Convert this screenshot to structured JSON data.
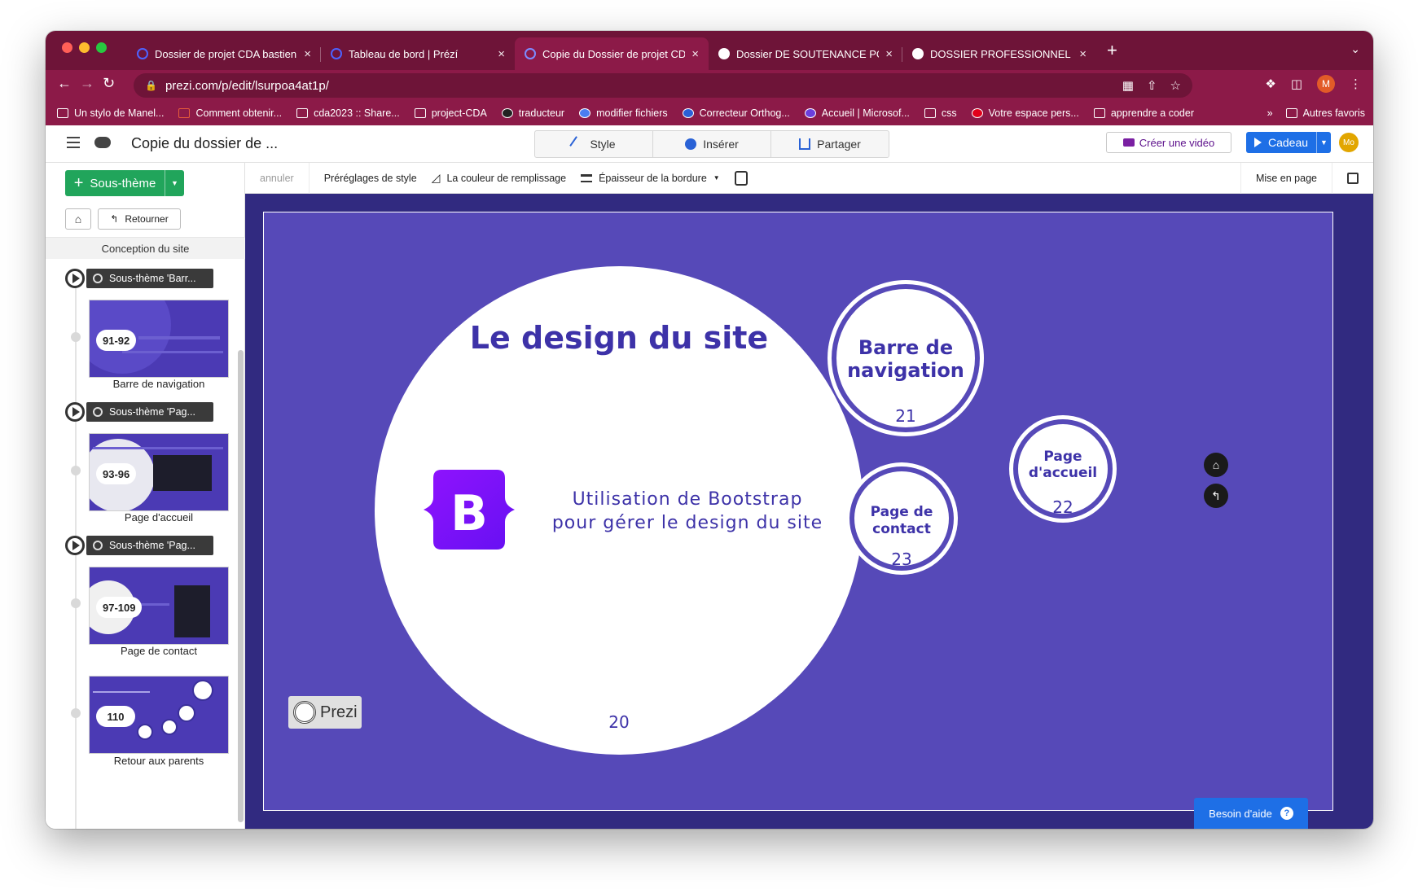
{
  "browser": {
    "tabs": [
      {
        "title": "Dossier de projet CDA bastien",
        "favicon_color": "#3b4fd8"
      },
      {
        "title": "Tableau de bord | Prézí",
        "favicon_color": "#3b4fd8"
      },
      {
        "title": "Copie du Dossier de projet CDA",
        "favicon_color": "#3b4fd8"
      },
      {
        "title": "Dossier DE SOUTENANCE POUR",
        "favicon_color": "#ffffff"
      },
      {
        "title": "DOSSIER PROFESSIONNEL (DP",
        "favicon_color": "#ffffff"
      }
    ],
    "close_glyph": "×",
    "new_tab_glyph": "+",
    "url": "prezi.com/p/edit/lsurpoa4at1p/",
    "profile_initial": "M",
    "bookmarks": [
      "Un stylo de Manel...",
      "Comment obtenir...",
      "cda2023 :: Share...",
      "project-CDA",
      "traducteur",
      "modifier fichiers",
      "Correcteur Orthog...",
      "Accueil | Microsof...",
      "css",
      "Votre espace pers...",
      "apprendre a coder"
    ],
    "bookmarks_overflow": "»",
    "other_bookmarks": "Autres favoris"
  },
  "app": {
    "doc_title": "Copie du dossier de ...",
    "segments": [
      {
        "label": "Style",
        "icon": "magic-wand-icon"
      },
      {
        "label": "Insérer",
        "icon": "plus-circle-icon"
      },
      {
        "label": "Partager",
        "icon": "share-upload-icon"
      }
    ],
    "create_video": "Créer une vidéo",
    "gift": "Cadeau",
    "user_initials": "Mo",
    "accent_color": "#1e6fe6"
  },
  "sidebar": {
    "add_label": "Sous-thème",
    "back_label": "Retourner",
    "crumb": "Conception du site",
    "subtopics": [
      {
        "tag": "Sous-thème 'Barr...",
        "badge": "91-92",
        "label": "Barre de navigation"
      },
      {
        "tag": "Sous-thème 'Pag...",
        "badge": "93-96",
        "label": "Page d'accueil"
      },
      {
        "tag": "Sous-thème 'Pag...",
        "badge": "97-109",
        "label": "Page de contact"
      }
    ],
    "last": {
      "badge": "110",
      "label": "Retour aux parents"
    }
  },
  "toolbar": {
    "undo": "annuler",
    "presets": "Préréglages de style",
    "fill": "La couleur de remplissage",
    "border": "Épaisseur de la bordure",
    "layout": "Mise en page"
  },
  "slide": {
    "title": "Le design du site",
    "logo_letter": "B",
    "line1": "Utilisation de Bootstrap",
    "line2": "pour gérer le design du site",
    "number": "20",
    "topics": [
      {
        "title_line1": "Barre de",
        "title_line2": "navigation",
        "number": "21"
      },
      {
        "title_line1": "Page",
        "title_line2": "d'accueil",
        "number": "22"
      },
      {
        "title_line1": "Page de",
        "title_line2": "contact",
        "number": "23"
      }
    ],
    "brand": "Prezi",
    "bg_color": "#5649b8",
    "text_color": "#3d32a8"
  },
  "help": {
    "label": "Besoin d'aide",
    "icon_glyph": "?"
  }
}
